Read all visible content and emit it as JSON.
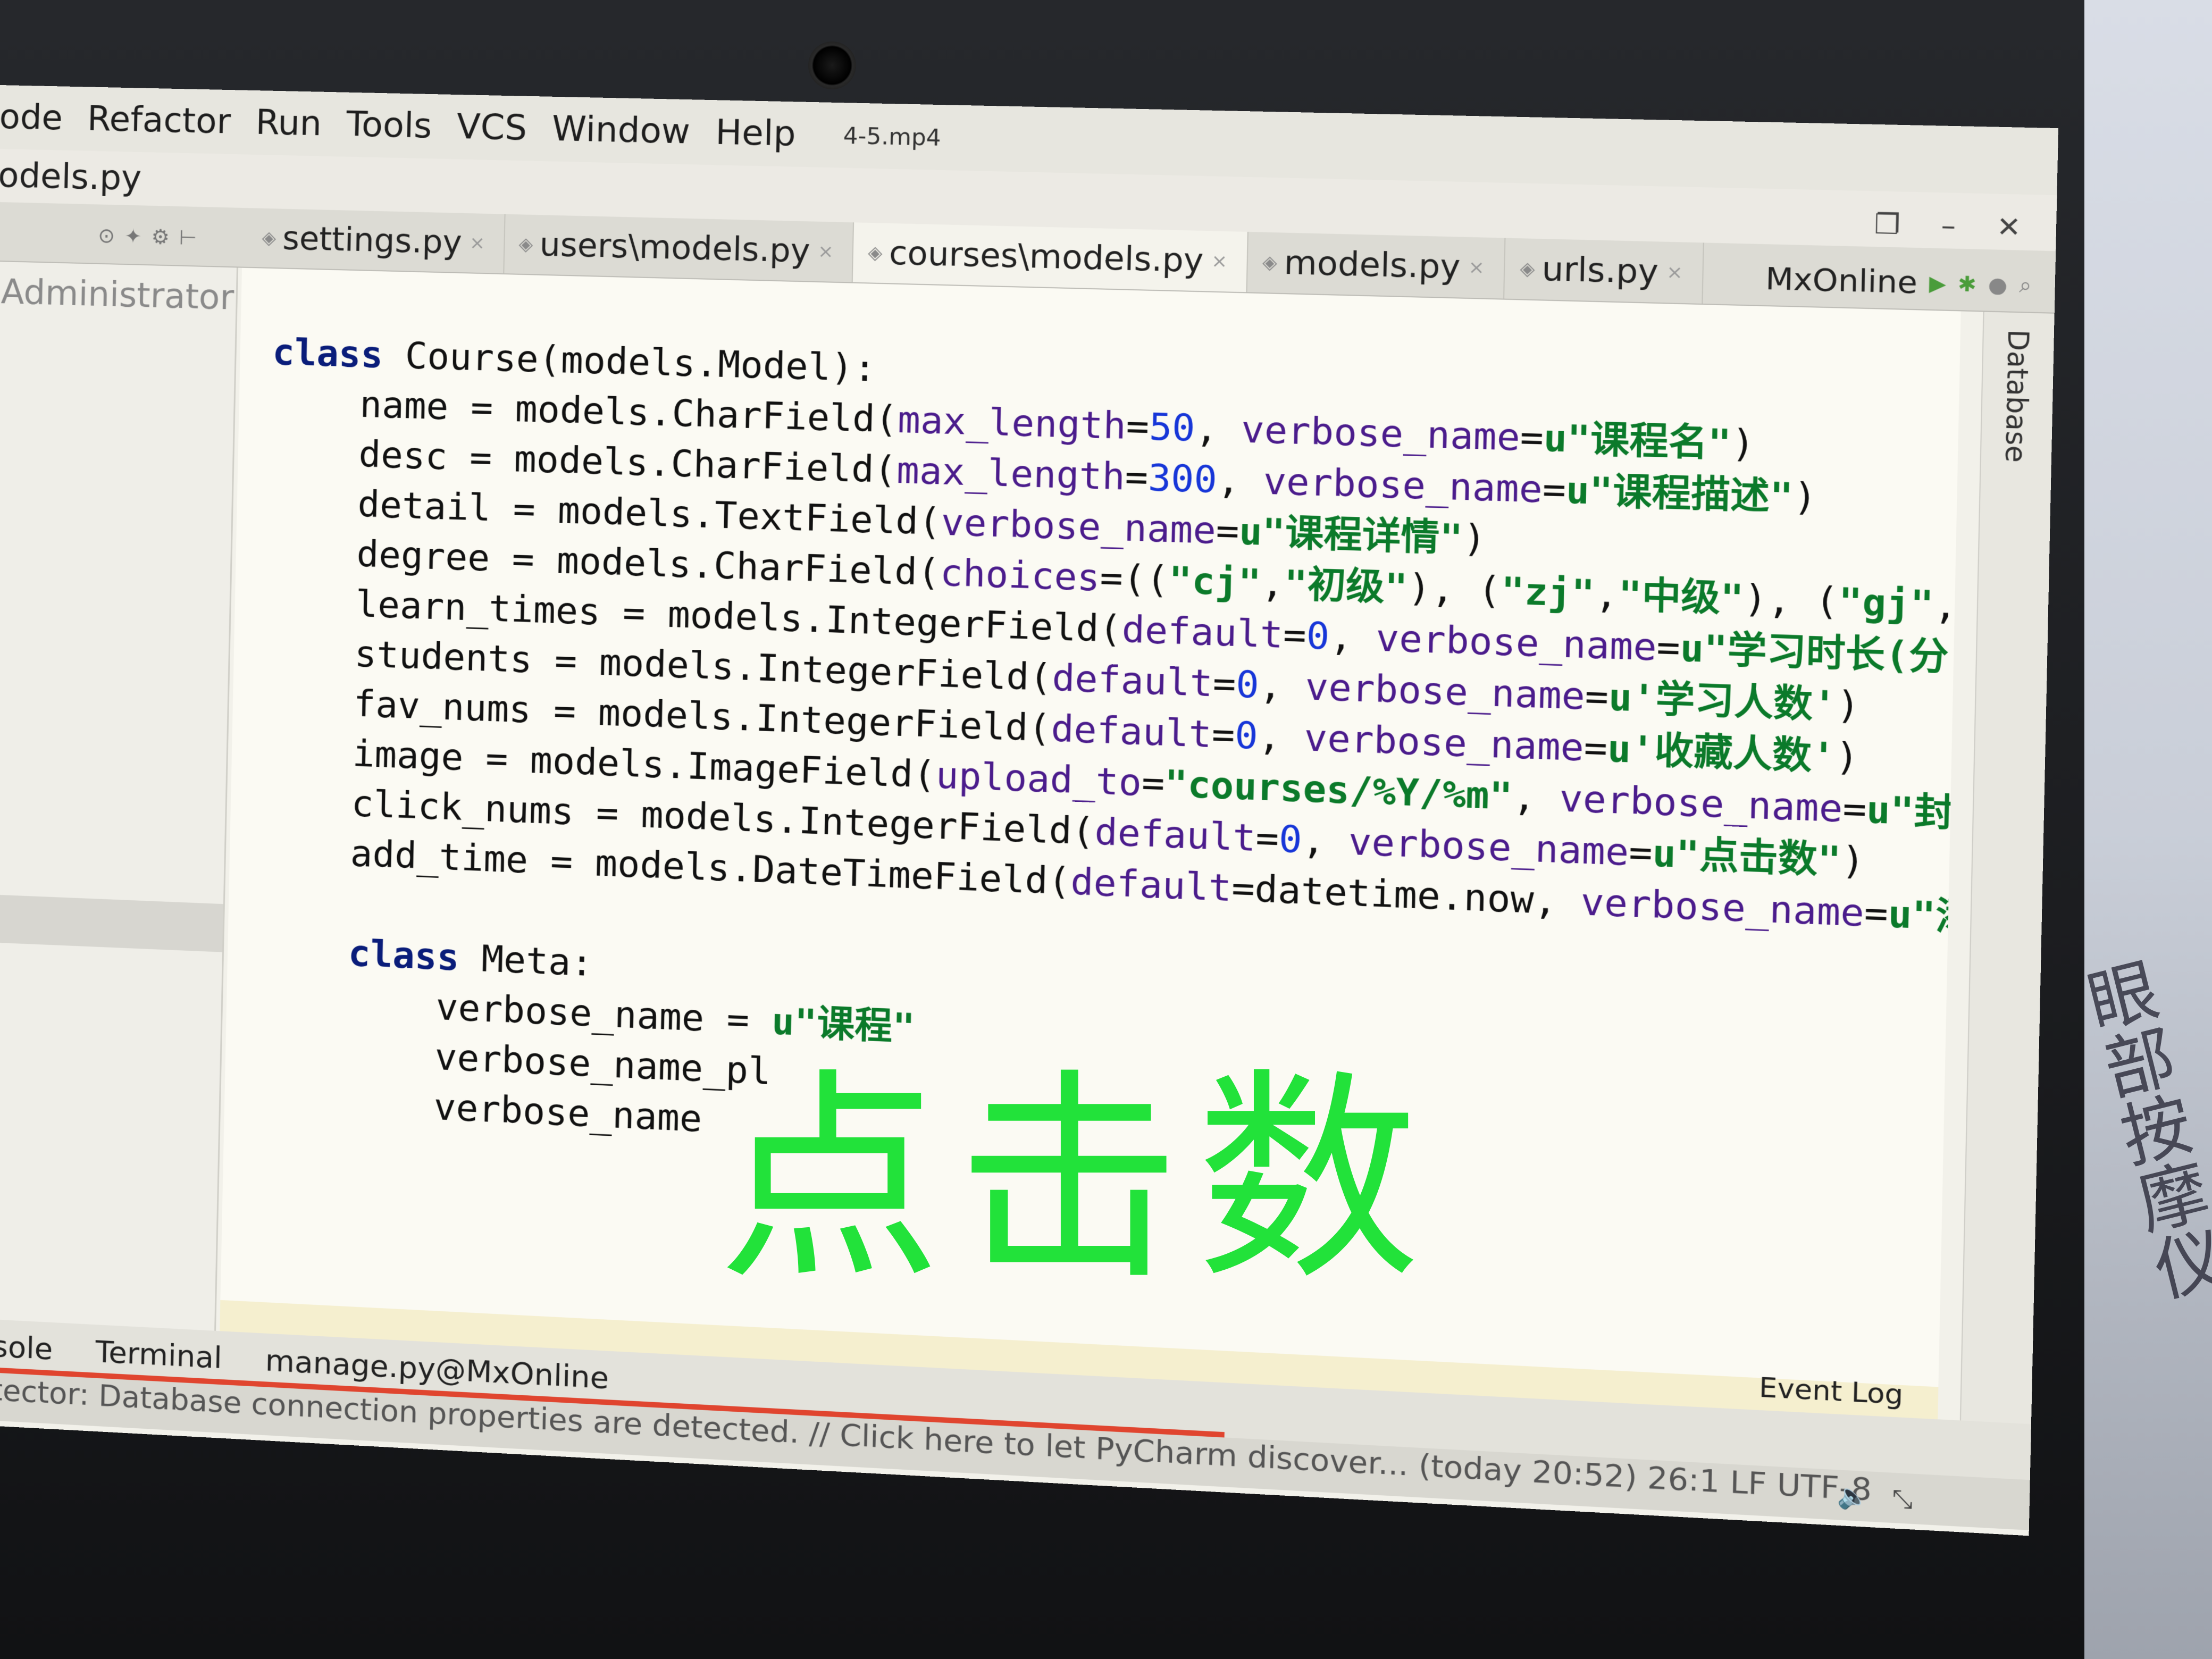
{
  "menu": {
    "items": [
      "ode",
      "Refactor",
      "Run",
      "Tools",
      "VCS",
      "Window",
      "Help"
    ],
    "video_title": "4-5.mp4"
  },
  "window": {
    "title": "odels.py",
    "controls": [
      "restore-icon",
      "minimize-icon",
      "close-icon"
    ]
  },
  "tabs": [
    {
      "label": "settings.py",
      "active": false
    },
    {
      "label": "users\\models.py",
      "active": false
    },
    {
      "label": "courses\\models.py",
      "active": true
    },
    {
      "label": "models.py",
      "active": false
    },
    {
      "label": "urls.py",
      "active": false
    }
  ],
  "run_config": {
    "label": "MxOnline"
  },
  "project_panel": {
    "label": "Administrator"
  },
  "side_panel": {
    "label": "Database"
  },
  "code": {
    "lines": [
      "class Course(models.Model):",
      "    name = models.CharField(max_length=50, verbose_name=u\"课程名\")",
      "    desc = models.CharField(max_length=300, verbose_name=u\"课程描述\")",
      "    detail = models.TextField(verbose_name=u\"课程详情\")",
      "    degree = models.CharField(choices=((\"cj\",\"初级\"), (\"zj\",\"中级\"), (\"gj\",",
      "    learn_times = models.IntegerField(default=0, verbose_name=u\"学习时长(分",
      "    students = models.IntegerField(default=0, verbose_name=u'学习人数')",
      "    fav_nums = models.IntegerField(default=0, verbose_name=u'收藏人数')",
      "    image = models.ImageField(upload_to=\"courses/%Y/%m\", verbose_name=u\"封",
      "    click_nums = models.IntegerField(default=0, verbose_name=u\"点击数\")",
      "    add_time = models.DateTimeField(default=datetime.now, verbose_name=u\"添",
      "",
      "    class Meta:",
      "        verbose_name = u\"课程\"",
      "        verbose_name_pl",
      "        verbose_name"
    ]
  },
  "bottom_tabs": [
    "nsole",
    "Terminal",
    "manage.py@MxOnline"
  ],
  "event_log": "Event Log",
  "status_text": "etector: Database connection properties are detected. // Click here to let PyCharm discover... (today 20:52)  26:1  LF  UTF-8",
  "subtitle": "点击数",
  "box_text": "眼部按摩仪",
  "colors": {
    "keyword": "#0a1d7a",
    "param": "#4b1c8c",
    "number": "#1736d8",
    "string": "#0b7a2a",
    "subtitle": "#22e23a",
    "progress": "#e0452f"
  }
}
